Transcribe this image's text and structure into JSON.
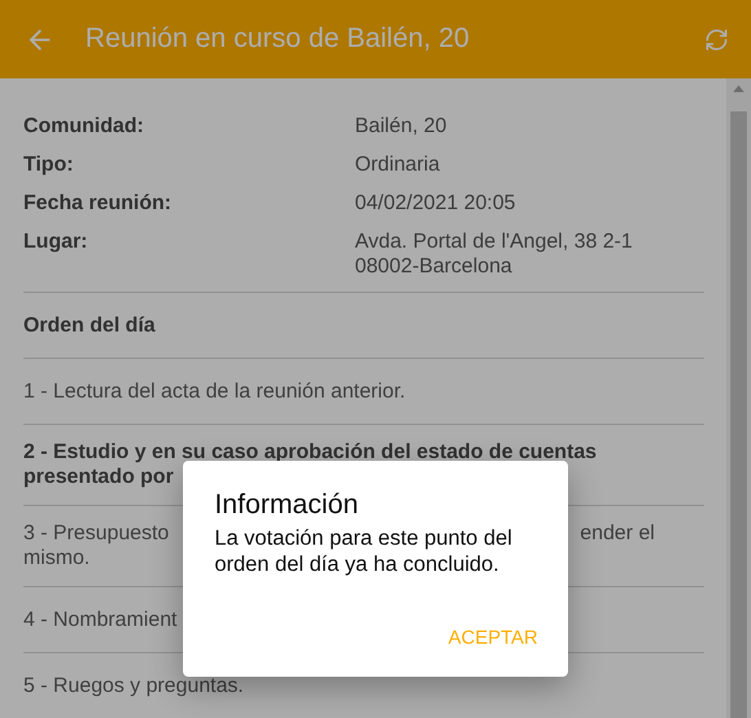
{
  "header": {
    "title": "Reunión en curso de Bailén, 20"
  },
  "details": [
    {
      "label": "Comunidad:",
      "value": [
        "Bailén, 20"
      ]
    },
    {
      "label": "Tipo:",
      "value": [
        "Ordinaria"
      ]
    },
    {
      "label": "Fecha reunión:",
      "value": [
        "04/02/2021 20:05"
      ]
    },
    {
      "label": "Lugar:",
      "value": [
        "Avda. Portal de l'Angel, 38 2-1",
        "08002-Barcelona"
      ]
    }
  ],
  "agenda": {
    "heading": "Orden del día",
    "items": [
      {
        "bold": false,
        "lines": [
          {
            "left": "1 - Lectura del acta de la reunión anterior."
          }
        ]
      },
      {
        "bold": true,
        "lines": [
          {
            "left": "2 - Estudio y en su caso aprobación del estado de cuentas"
          },
          {
            "left": "presentado por"
          }
        ]
      },
      {
        "bold": false,
        "lines": [
          {
            "left": "3 - Presupuesto",
            "right": "ender el"
          },
          {
            "left": "mismo."
          }
        ]
      },
      {
        "bold": false,
        "lines": [
          {
            "left": "4 - Nombramient"
          }
        ]
      },
      {
        "bold": false,
        "lines": [
          {
            "left": "5 - Ruegos y preguntas."
          }
        ]
      }
    ]
  },
  "dialog": {
    "title": "Información",
    "message": "La votación para este punto del orden del día ya ha concluido.",
    "button": "ACEPTAR"
  }
}
